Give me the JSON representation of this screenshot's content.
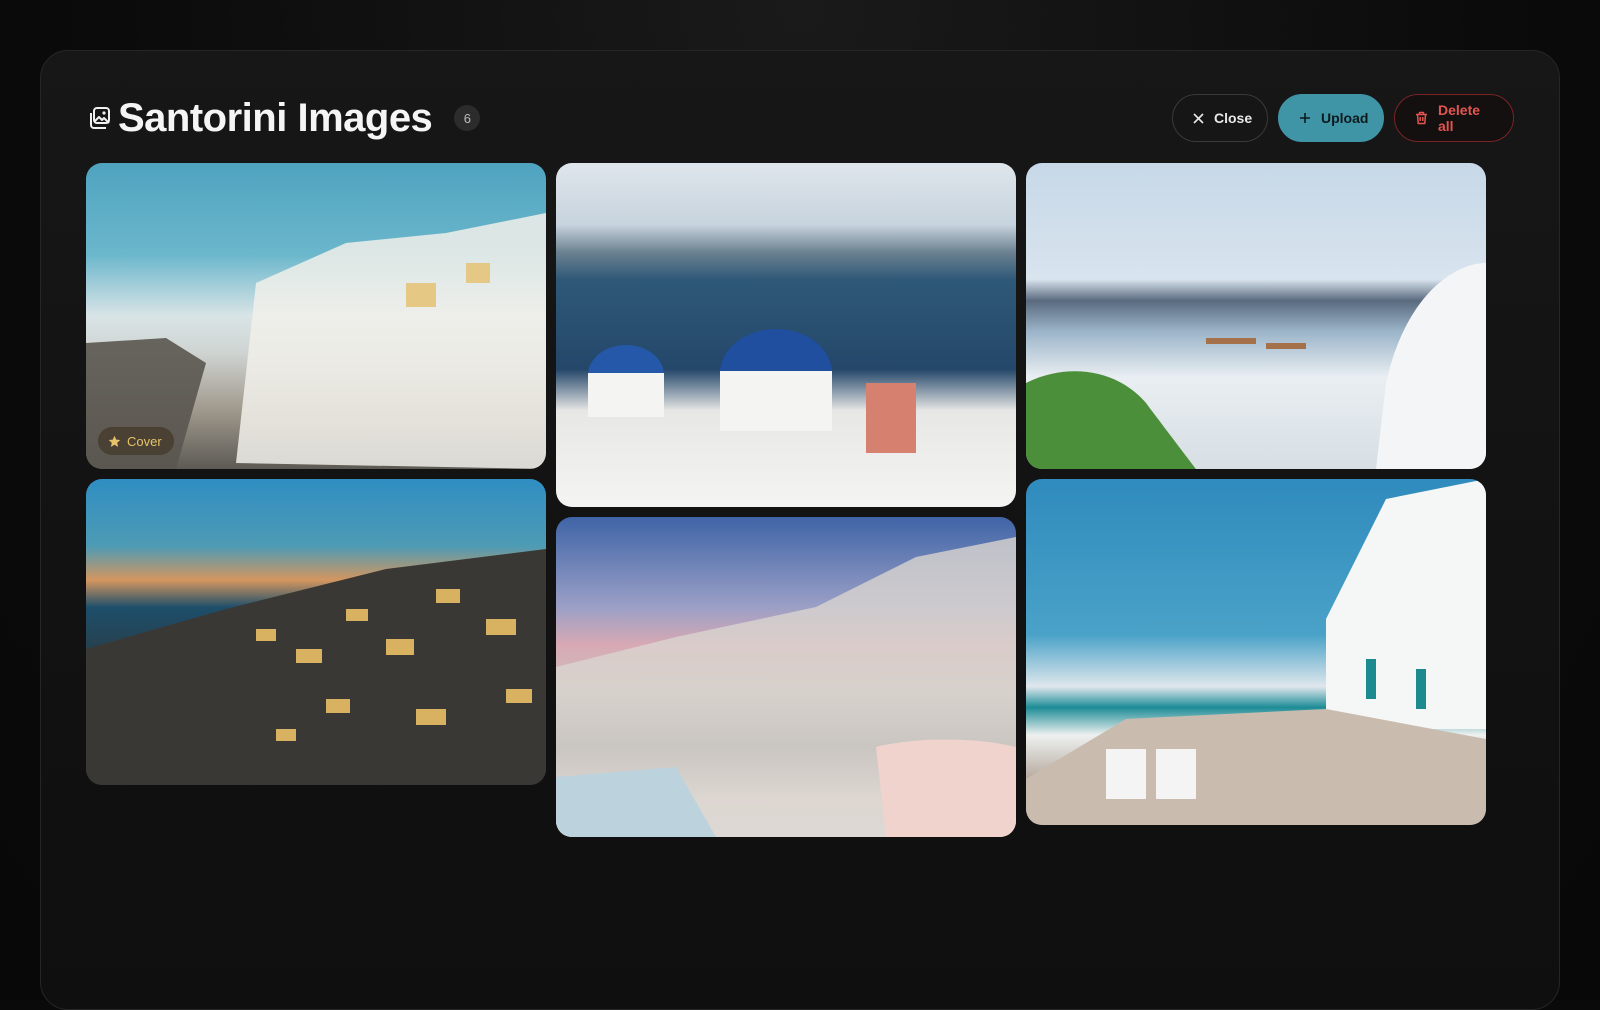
{
  "header": {
    "title": "Santorini Images",
    "count": "6",
    "title_icon": "image-stack-icon"
  },
  "actions": {
    "close_label": "Close",
    "upload_label": "Upload",
    "delete_label": "Delete all"
  },
  "images": [
    {
      "subject": "Santorini village, daytime",
      "cover": true
    },
    {
      "subject": "Blue-domed churches over caldera"
    },
    {
      "subject": "White terrace with sea view"
    },
    {
      "subject": "Village lights at dusk"
    },
    {
      "subject": "Sunset over village"
    },
    {
      "subject": "Seaside taverna promenade"
    }
  ],
  "cover_label": "Cover",
  "colors": {
    "accent": "#3f94a6",
    "danger": "#e2554f",
    "cover_star": "#e6c36b"
  }
}
